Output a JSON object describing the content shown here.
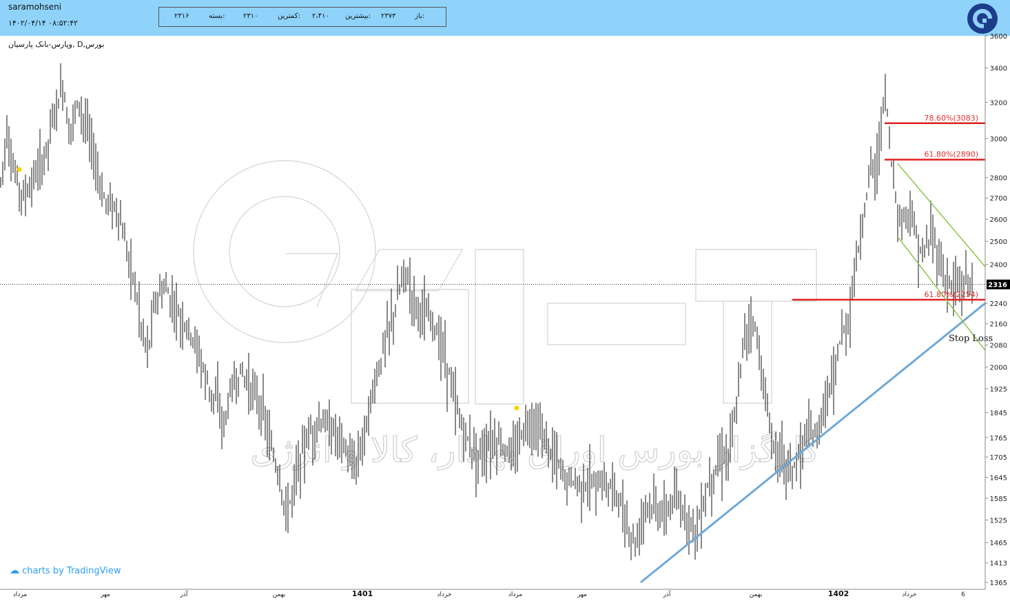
{
  "header": {
    "username": "saramohseni",
    "datetime": "۱۴۰۲/۰۴/۱۴ ۰۸:۵۲:۴۲",
    "ohlc": {
      "open_label": "باز:",
      "open_value": "۲۳۷۳",
      "high_label": "بیشترین:",
      "high_value": "۲،۴۱۰",
      "low_label": "کمترین:",
      "low_value": "۲۳۱۰",
      "close_label": "بسته:",
      "close_value": "۲۳۱۶"
    },
    "logo_icon": "circle-q-logo-icon"
  },
  "symbol_line": "بورس,D ,وپارس-بانک پارسیان",
  "watermark_text": "کارگزار بورس اوراق بهادار، کالا و انرژی",
  "tradingview_label": "charts by TradingView",
  "colors": {
    "header_bg": "#8fd3fb",
    "fib_red": "#e02020",
    "trend_blue": "#6fa8d6",
    "channel_green": "#8bc34a",
    "marker_yellow": "#ffd200"
  },
  "chart_data": {
    "type": "bar",
    "scale": "log",
    "ylim": [
      1340,
      3650
    ],
    "y_ticks": [
      3600,
      3400,
      3200,
      3000,
      2800,
      2700,
      2600,
      2500,
      2400,
      2240,
      2160,
      2080,
      2000,
      1925,
      1845,
      1765,
      1705,
      1645,
      1585,
      1525,
      1465,
      1413,
      1365
    ],
    "last_price": 2316,
    "last_price_label": "2316",
    "x_labels": [
      "مرداد",
      "مهر",
      "آذر",
      "بهمن",
      "1401",
      "خرداد",
      "مرداد",
      "مهر",
      "آذر",
      "بهمن",
      "1402",
      "خرداد",
      "6"
    ],
    "bold_x_labels": [
      "1401",
      "1402"
    ],
    "close_path": [
      [
        0,
        2750
      ],
      [
        10,
        3050
      ],
      [
        20,
        2820
      ],
      [
        35,
        2700
      ],
      [
        50,
        2800
      ],
      [
        65,
        2900
      ],
      [
        80,
        3150
      ],
      [
        92,
        3300
      ],
      [
        100,
        3050
      ],
      [
        115,
        3200
      ],
      [
        130,
        3000
      ],
      [
        150,
        2700
      ],
      [
        170,
        2650
      ],
      [
        185,
        2450
      ],
      [
        195,
        2330
      ],
      [
        205,
        2150
      ],
      [
        215,
        2050
      ],
      [
        225,
        2250
      ],
      [
        240,
        2300
      ],
      [
        255,
        2220
      ],
      [
        270,
        2150
      ],
      [
        285,
        2080
      ],
      [
        300,
        1950
      ],
      [
        315,
        1880
      ],
      [
        325,
        1800
      ],
      [
        335,
        1920
      ],
      [
        350,
        1980
      ],
      [
        365,
        1930
      ],
      [
        380,
        1860
      ],
      [
        395,
        1720
      ],
      [
        405,
        1650
      ],
      [
        415,
        1540
      ],
      [
        425,
        1600
      ],
      [
        435,
        1700
      ],
      [
        450,
        1780
      ],
      [
        465,
        1820
      ],
      [
        480,
        1790
      ],
      [
        495,
        1760
      ],
      [
        510,
        1680
      ],
      [
        520,
        1700
      ],
      [
        530,
        1800
      ],
      [
        545,
        1950
      ],
      [
        560,
        2100
      ],
      [
        575,
        2230
      ],
      [
        588,
        2380
      ],
      [
        600,
        2260
      ],
      [
        615,
        2200
      ],
      [
        630,
        2150
      ],
      [
        645,
        2060
      ],
      [
        658,
        1900
      ],
      [
        670,
        1800
      ],
      [
        685,
        1730
      ],
      [
        700,
        1720
      ],
      [
        715,
        1760
      ],
      [
        730,
        1740
      ],
      [
        745,
        1700
      ],
      [
        760,
        1800
      ],
      [
        775,
        1820
      ],
      [
        790,
        1760
      ],
      [
        805,
        1700
      ],
      [
        820,
        1640
      ],
      [
        840,
        1630
      ],
      [
        860,
        1620
      ],
      [
        880,
        1630
      ],
      [
        895,
        1600
      ],
      [
        905,
        1540
      ],
      [
        915,
        1480
      ],
      [
        925,
        1470
      ],
      [
        935,
        1570
      ],
      [
        950,
        1560
      ],
      [
        965,
        1540
      ],
      [
        980,
        1580
      ],
      [
        995,
        1540
      ],
      [
        1010,
        1500
      ],
      [
        1020,
        1560
      ],
      [
        1030,
        1640
      ],
      [
        1045,
        1700
      ],
      [
        1058,
        1720
      ],
      [
        1070,
        1860
      ],
      [
        1080,
        2120
      ],
      [
        1090,
        2180
      ],
      [
        1100,
        2100
      ],
      [
        1110,
        1900
      ],
      [
        1120,
        1760
      ],
      [
        1130,
        1720
      ],
      [
        1140,
        1690
      ],
      [
        1150,
        1670
      ],
      [
        1160,
        1700
      ],
      [
        1170,
        1780
      ],
      [
        1180,
        1760
      ],
      [
        1190,
        1800
      ],
      [
        1200,
        1900
      ],
      [
        1210,
        1950
      ],
      [
        1220,
        2100
      ],
      [
        1230,
        2150
      ],
      [
        1240,
        2350
      ],
      [
        1250,
        2550
      ],
      [
        1258,
        2700
      ],
      [
        1265,
        2900
      ],
      [
        1272,
        2800
      ],
      [
        1280,
        3150
      ],
      [
        1286,
        3250
      ],
      [
        1292,
        2920
      ],
      [
        1298,
        2780
      ],
      [
        1305,
        2580
      ],
      [
        1312,
        2620
      ],
      [
        1320,
        2650
      ],
      [
        1330,
        2520
      ],
      [
        1340,
        2420
      ],
      [
        1352,
        2550
      ],
      [
        1362,
        2440
      ],
      [
        1372,
        2330
      ],
      [
        1382,
        2310
      ],
      [
        1395,
        2300
      ],
      [
        1405,
        2340
      ],
      [
        1412,
        2316
      ]
    ],
    "fib_levels": [
      {
        "label": "78.60%(3083)",
        "value": 3083
      },
      {
        "label": "61.80%(2890)",
        "value": 2890
      },
      {
        "label": "61.80%(2254)",
        "value": 2254
      }
    ],
    "annotations": [
      "Stop Loss"
    ],
    "trendline": {
      "from": {
        "bar_x": 930,
        "price": 1365
      },
      "to": {
        "bar_x": 1430,
        "price": 2240
      }
    },
    "channel": {
      "upper": {
        "from": {
          "bar_x": 1303,
          "price": 2870
        },
        "to": {
          "bar_x": 1430,
          "price": 2390
        }
      },
      "lower": {
        "from": {
          "bar_x": 1303,
          "price": 2520
        },
        "to": {
          "bar_x": 1430,
          "price": 2060
        }
      }
    },
    "markers": [
      {
        "bar_x": 28,
        "price": 2840
      },
      {
        "bar_x": 750,
        "price": 1860
      }
    ]
  }
}
